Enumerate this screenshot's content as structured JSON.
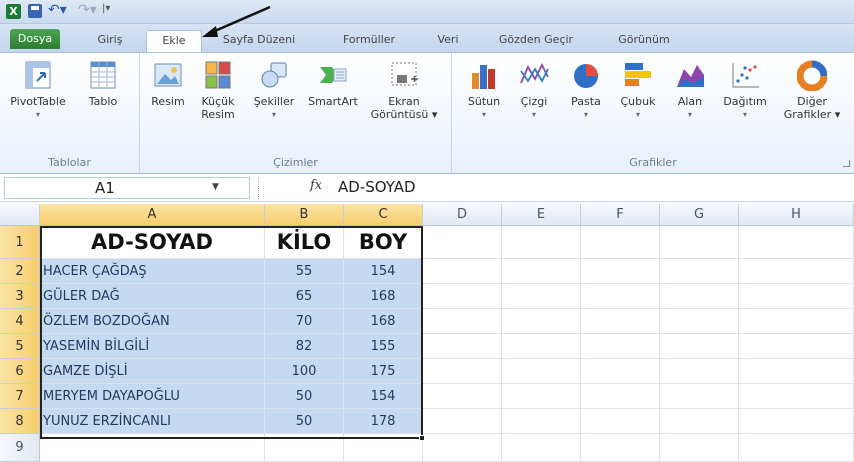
{
  "quick_access": {
    "app_icon_letter": "X",
    "customize_glyph": "|▾"
  },
  "tabs": [
    {
      "label": "Dosya"
    },
    {
      "label": "Giriş"
    },
    {
      "label": "Ekle"
    },
    {
      "label": "Sayfa Düzeni"
    },
    {
      "label": "Formüller"
    },
    {
      "label": "Veri"
    },
    {
      "label": "Gözden Geçir"
    },
    {
      "label": "Görünüm"
    }
  ],
  "active_tab": "Ekle",
  "ribbon": {
    "groups": [
      {
        "label": "Tablolar"
      },
      {
        "label": "Çizimler"
      },
      {
        "label": "Grafikler"
      }
    ],
    "buttons": {
      "pivottable": {
        "line1": "PivotTable",
        "line2": "▾"
      },
      "tablo": {
        "line1": "Tablo",
        "line2": ""
      },
      "resim": {
        "line1": "Resim",
        "line2": ""
      },
      "kucuk_resim": {
        "line1": "Küçük",
        "line2": "Resim"
      },
      "sekiller": {
        "line1": "Şekiller",
        "line2": "▾"
      },
      "smartart": {
        "line1": "SmartArt",
        "line2": ""
      },
      "ekran": {
        "line1": "Ekran",
        "line2": "Görüntüsü ▾"
      },
      "sutun": {
        "line1": "Sütun",
        "line2": "▾"
      },
      "cizgi": {
        "line1": "Çizgi",
        "line2": "▾"
      },
      "pasta": {
        "line1": "Pasta",
        "line2": "▾"
      },
      "cubuk": {
        "line1": "Çubuk",
        "line2": "▾"
      },
      "alan": {
        "line1": "Alan",
        "line2": "▾"
      },
      "dagitim": {
        "line1": "Dağıtım",
        "line2": "▾"
      },
      "diger": {
        "line1": "Diğer",
        "line2": "Grafikler ▾"
      }
    }
  },
  "formula_bar": {
    "name_box": "A1",
    "fx": "fx",
    "value": "AD-SOYAD"
  },
  "columns": [
    "A",
    "B",
    "C",
    "D",
    "E",
    "F",
    "G",
    "H"
  ],
  "rows": [
    "1",
    "2",
    "3",
    "4",
    "5",
    "6",
    "7",
    "8",
    "9"
  ],
  "table": {
    "headers": [
      "AD-SOYAD",
      "KİLO",
      "BOY"
    ],
    "rows": [
      [
        "HACER  ÇAĞDAŞ",
        "55",
        "154"
      ],
      [
        "GÜLER DAĞ",
        "65",
        "168"
      ],
      [
        "ÖZLEM BOZDOĞAN",
        "70",
        "168"
      ],
      [
        "YASEMİN BİLGİLİ",
        "82",
        "155"
      ],
      [
        "GAMZE DİŞLİ",
        "100",
        "175"
      ],
      [
        "MERYEM DAYAPOĞLU",
        "50",
        "154"
      ],
      [
        "YUNUZ ERZİNCANLI",
        "50",
        "178"
      ]
    ]
  },
  "colors": {
    "selection_fill": "#c5d9f1",
    "file_tab": "#2e7d32",
    "header_highlight": "#f6cd6b"
  }
}
